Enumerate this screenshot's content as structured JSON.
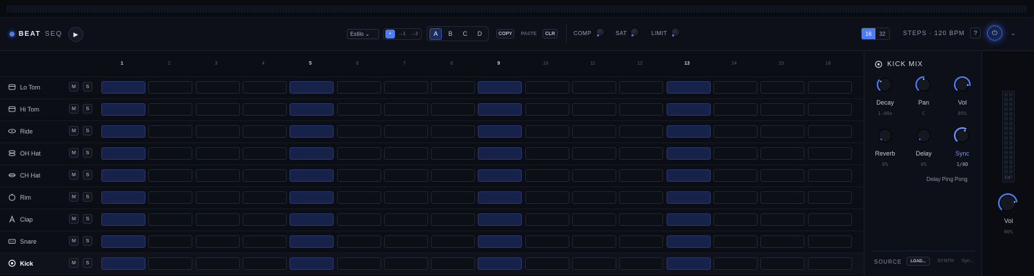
{
  "app": {
    "brand": "BEAT",
    "brand_sub": "SEQ"
  },
  "toolbar": {
    "play_icon": "▶",
    "style_select": "Estilo",
    "swing_options": [
      "•",
      "→1",
      "→2"
    ],
    "patterns": [
      "A",
      "B",
      "C",
      "D"
    ],
    "active_pattern": "A",
    "copy": "COPY",
    "paste": "PASTE",
    "clear": "CLR",
    "fx": [
      "COMP",
      "SAT",
      "LIMIT"
    ],
    "steps_options": [
      "16",
      "32"
    ],
    "active_steps": "16",
    "steps_bpm": "STEPS · 120 BPM",
    "help": "?",
    "power_icon": "⏻",
    "chevron": "⌄"
  },
  "step_numbers": [
    "1",
    "2",
    "3",
    "4",
    "5",
    "6",
    "7",
    "8",
    "9",
    "10",
    "11",
    "12",
    "13",
    "14",
    "15",
    "16"
  ],
  "accent_steps": [
    1,
    5,
    9,
    13
  ],
  "tracks": [
    {
      "name": "Lo Tom",
      "icon": "tom-icon",
      "steps": [
        1,
        0,
        0,
        0,
        1,
        0,
        0,
        0,
        1,
        0,
        0,
        0,
        1,
        0,
        0,
        0
      ]
    },
    {
      "name": "Hi Tom",
      "icon": "tom-icon",
      "steps": [
        1,
        0,
        0,
        0,
        1,
        0,
        0,
        0,
        1,
        0,
        0,
        0,
        1,
        0,
        0,
        0
      ]
    },
    {
      "name": "Ride",
      "icon": "ride-icon",
      "steps": [
        1,
        0,
        0,
        0,
        1,
        0,
        0,
        0,
        1,
        0,
        0,
        0,
        1,
        0,
        0,
        0
      ]
    },
    {
      "name": "OH Hat",
      "icon": "open-hat-icon",
      "steps": [
        1,
        0,
        0,
        0,
        1,
        0,
        0,
        0,
        1,
        0,
        0,
        0,
        1,
        0,
        0,
        0
      ]
    },
    {
      "name": "CH Hat",
      "icon": "closed-hat-icon",
      "steps": [
        1,
        0,
        0,
        0,
        1,
        0,
        0,
        0,
        1,
        0,
        0,
        0,
        1,
        0,
        0,
        0
      ]
    },
    {
      "name": "Rim",
      "icon": "rim-icon",
      "steps": [
        1,
        0,
        0,
        0,
        1,
        0,
        0,
        0,
        1,
        0,
        0,
        0,
        1,
        0,
        0,
        0
      ]
    },
    {
      "name": "Clap",
      "icon": "clap-icon",
      "steps": [
        1,
        0,
        0,
        0,
        1,
        0,
        0,
        0,
        1,
        0,
        0,
        0,
        1,
        0,
        0,
        0
      ]
    },
    {
      "name": "Snare",
      "icon": "snare-icon",
      "steps": [
        1,
        0,
        0,
        0,
        1,
        0,
        0,
        0,
        1,
        0,
        0,
        0,
        1,
        0,
        0,
        0
      ]
    },
    {
      "name": "Kick",
      "icon": "kick-icon",
      "steps": [
        1,
        0,
        0,
        0,
        1,
        0,
        0,
        0,
        1,
        0,
        0,
        0,
        1,
        0,
        0,
        0
      ],
      "selected": true
    }
  ],
  "mute_label": "M",
  "solo_label": "S",
  "mix": {
    "title": "KICK MIX",
    "knobs": [
      {
        "label": "Decay",
        "value": "1.00x",
        "level": 0.3
      },
      {
        "label": "Pan",
        "value": "C",
        "level": 0.5
      },
      {
        "label": "Vol",
        "value": "85%",
        "level": 0.85
      },
      {
        "label": "Reverb",
        "value": "0%",
        "level": 0
      },
      {
        "label": "Delay",
        "value": "0%",
        "level": 0
      },
      {
        "label": "Sync",
        "value": "1/8D",
        "level": 0.6,
        "highlight": true
      }
    ],
    "delay_mode": "Delay Ping Pong",
    "source_label": "SOURCE",
    "source_buttons": [
      "LOAD...",
      "SYNTH",
      "Syn..."
    ]
  },
  "master": {
    "meter_label": "L R",
    "label": "Vol",
    "value": "80%",
    "level": 0.8
  },
  "colors": {
    "accent": "#4f7cf5",
    "bg": "#0c0e15",
    "active_cell": "#16224a"
  }
}
